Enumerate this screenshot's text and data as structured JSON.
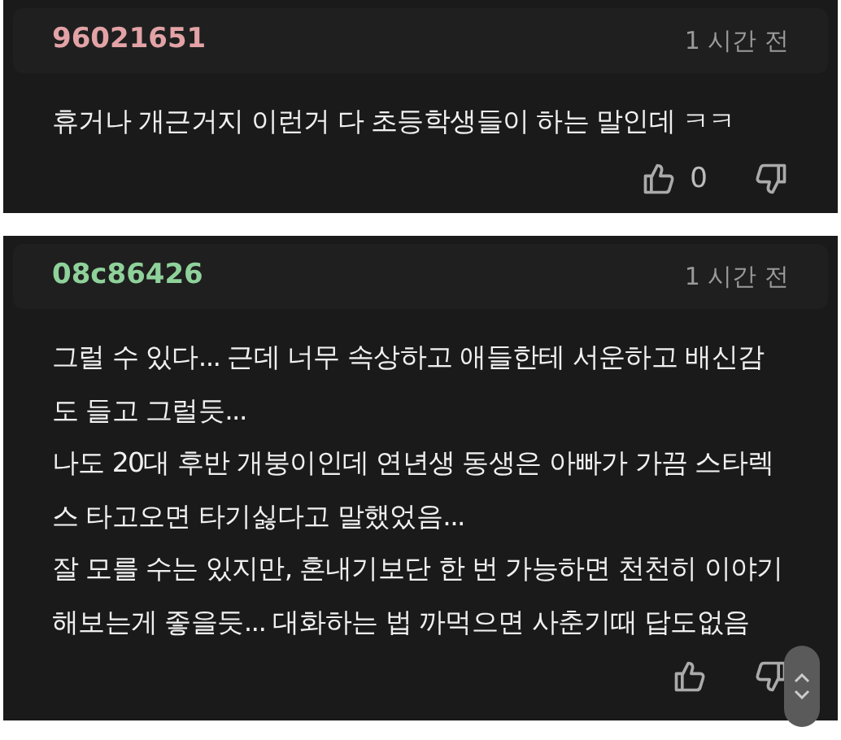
{
  "comments": [
    {
      "author": "96021651",
      "color": "#e3a3a6",
      "time": "1 시간 전",
      "paragraphs": [
        "휴거나 개근거지 이런거 다 초등학생들이 하는 말인데 ㅋㅋ"
      ],
      "likes": "0"
    },
    {
      "author": "08c86426",
      "color": "#8fd19a",
      "time": "1 시간 전",
      "paragraphs": [
        "그럴 수 있다... 근데 너무 속상하고 애들한테 서운하고 배신감도 들고 그럴듯...",
        "나도 20대 후반 개붕이인데 연년생 동생은 아빠가 가끔 스타렉스 타고오면 타기싫다고 말했었음...",
        "잘 모를 수는 있지만, 혼내기보단 한 번 가능하면 천천히 이야기해보는게 좋을듯... 대화하는 법 까먹으면 사춘기때 답도없음"
      ]
    }
  ]
}
